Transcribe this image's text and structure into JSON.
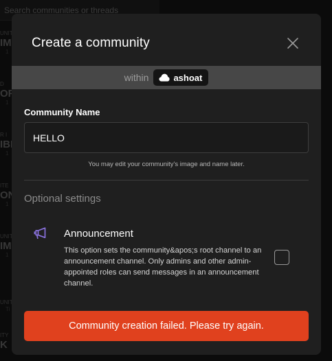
{
  "background": {
    "search_text": "Search communities or threads",
    "items": [
      {
        "caption": "UNIT",
        "big": "IMI",
        "sub": "1"
      },
      {
        "caption": "D",
        "big": "OR",
        "sub": "1"
      },
      {
        "caption": "R I",
        "big": "IBI",
        "sub": "1"
      },
      {
        "caption": "ITE",
        "big": "ON",
        "sub": "1"
      },
      {
        "caption": "UNIT",
        "big": "IMI",
        "sub": "1"
      },
      {
        "caption": "UNIT",
        "big": "",
        "sub": "Ti"
      },
      {
        "caption": "ITY",
        "big": "K",
        "sub": ""
      }
    ]
  },
  "modal": {
    "title": "Create a community",
    "within": {
      "label": "within",
      "community": "ashoat"
    },
    "name_field": {
      "label": "Community Name",
      "value": "HELLO"
    },
    "helper_text": "You may edit your community's image and name later.",
    "optional_heading": "Optional settings",
    "announcement": {
      "title": "Announcement",
      "description": "This option sets the community&apos;s root channel to an announcement channel. Only admins and other admin-appointed roles can send messages in an announcement channel.",
      "icon": "megaphone-icon",
      "checked": false
    },
    "error_button": "Community creation failed. Please try again."
  },
  "colors": {
    "modal_bg": "#1f1f1f",
    "within_bar": "#474747",
    "accent_icon": "#8b73e0",
    "error": "#e0411e"
  }
}
